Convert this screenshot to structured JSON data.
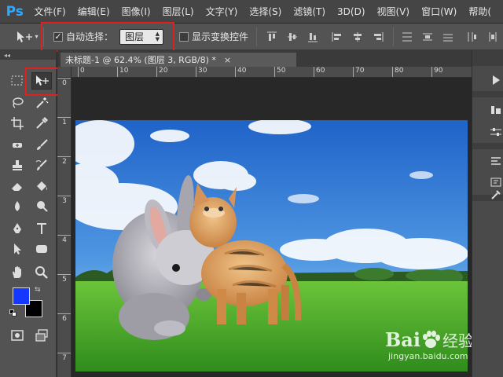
{
  "app": {
    "logo": "Ps"
  },
  "menu": [
    "文件(F)",
    "编辑(E)",
    "图像(I)",
    "图层(L)",
    "文字(Y)",
    "选择(S)",
    "滤镜(T)",
    "3D(D)",
    "视图(V)",
    "窗口(W)",
    "帮助("
  ],
  "options": {
    "auto_select_label": "自动选择：",
    "auto_select_checked": true,
    "auto_select_value": "图层",
    "show_transform_label": "显示变换控件",
    "show_transform_checked": false
  },
  "document": {
    "tab_title": "未标题-1 @ 62.4% (图层 3, RGB/8) *",
    "close_glyph": "×"
  },
  "rulers": {
    "horizontal": [
      "0",
      "10",
      "20",
      "30",
      "40",
      "50",
      "60",
      "70",
      "80",
      "90"
    ],
    "vertical": [
      "0",
      "1",
      "2",
      "3",
      "4",
      "5",
      "6",
      "7"
    ]
  },
  "colors": {
    "foreground": "#1438ff",
    "background": "#000000",
    "highlight": "#e02020"
  },
  "watermark": {
    "brand": "Bai",
    "brand_suffix": "经验",
    "url": "jingyan.baidu.com"
  }
}
